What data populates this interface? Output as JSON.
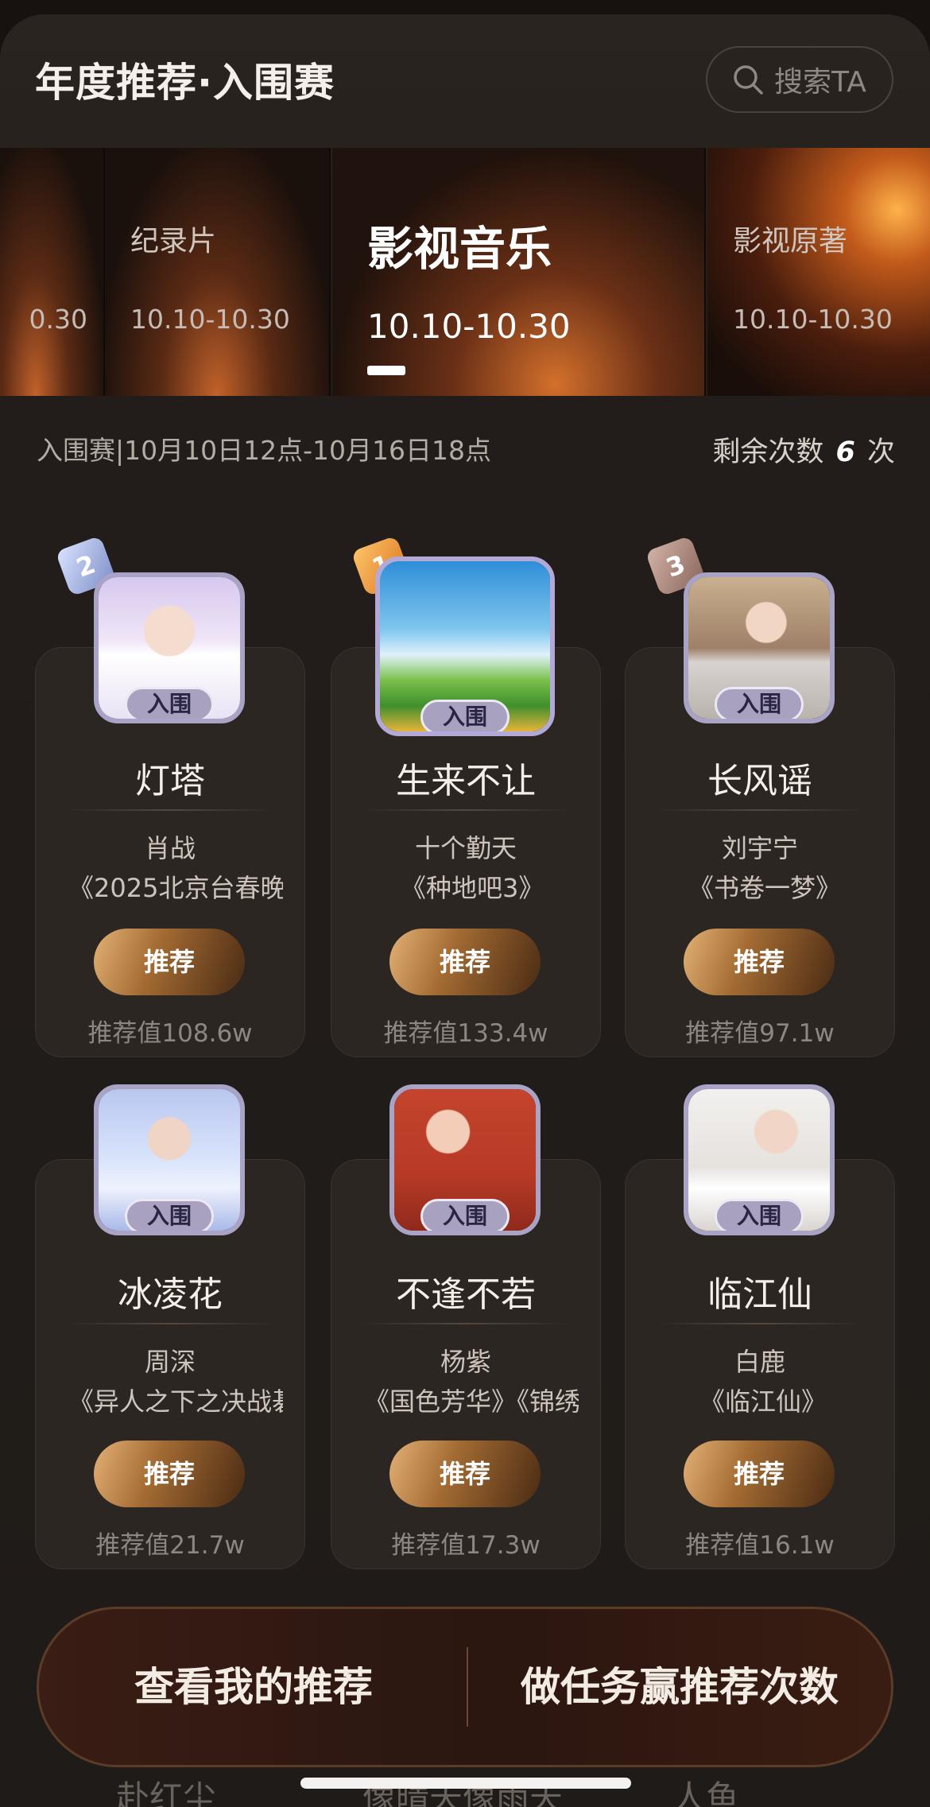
{
  "header": {
    "title": "年度推荐·入围赛",
    "search_placeholder": "搜索TA"
  },
  "tabs": [
    {
      "name": "",
      "date": "0.30"
    },
    {
      "name": "纪录片",
      "date": "10.10-10.30"
    },
    {
      "name": "影视音乐",
      "date": "10.10-10.30",
      "selected": true
    },
    {
      "name": "影视原著",
      "date": "10.10-10.30"
    }
  ],
  "round_info": "入围赛|10月10日12点-10月16日18点",
  "remaining": {
    "prefix": "剩余次数",
    "count": "6",
    "suffix": "次"
  },
  "cards": [
    {
      "rank": "2",
      "song": "灯塔",
      "artist": "肖战",
      "show": "《2025北京台春晚",
      "button": "推荐",
      "score": "推荐值108.6w",
      "tag": "入围"
    },
    {
      "rank": "1",
      "song": "生来不让",
      "artist": "十个勤天",
      "show": "《种地吧3》",
      "button": "推荐",
      "score": "推荐值133.4w",
      "tag": "入围"
    },
    {
      "rank": "3",
      "song": "长风谣",
      "artist": "刘宇宁",
      "show": "《书卷一梦》",
      "button": "推荐",
      "score": "推荐值97.1w",
      "tag": "入围"
    },
    {
      "rank": "",
      "song": "冰凌花",
      "artist": "周深",
      "show": "《异人之下之决战碁",
      "button": "推荐",
      "score": "推荐值21.7w",
      "tag": "入围"
    },
    {
      "rank": "",
      "song": "不逢不若",
      "artist": "杨紫",
      "show": "《国色芳华》《锦绣",
      "button": "推荐",
      "score": "推荐值17.3w",
      "tag": "入围"
    },
    {
      "rank": "",
      "song": "临江仙",
      "artist": "白鹿",
      "show": "《临江仙》",
      "button": "推荐",
      "score": "推荐值16.1w",
      "tag": "入围"
    }
  ],
  "peek": [
    "赴红尘",
    "像晴天像雨天",
    "人鱼"
  ],
  "bottom_bar": {
    "left": "查看我的推荐",
    "right": "做任务赢推荐次数"
  },
  "colors": {
    "accent": "#c2622a",
    "button": "#a36b33",
    "tag": "#a8a1c0"
  },
  "icons": {
    "search": "search-icon",
    "rank_badge": "rank-badge-icon"
  }
}
